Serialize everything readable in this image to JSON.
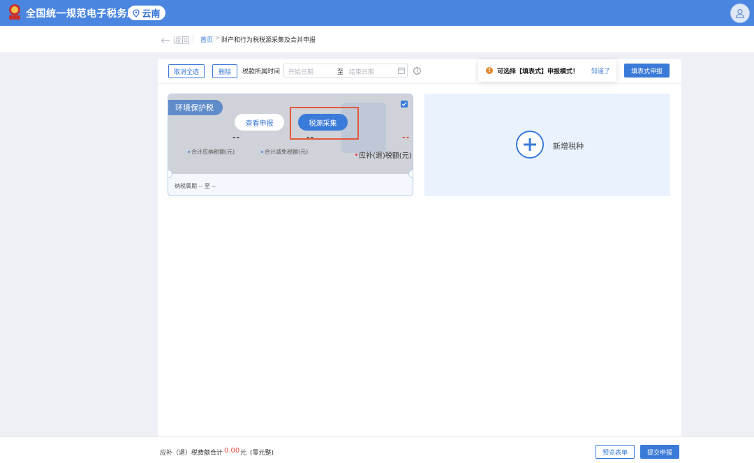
{
  "header": {
    "site_title": "全国统一规范电子税务局",
    "region": "云南",
    "brand_color": "#4a86e0"
  },
  "breadcrumb": {
    "back_label": "返回",
    "home": "首页",
    "separator": ">",
    "current": "财产和行为税税源采集及合并申报"
  },
  "toolbar": {
    "cancel_all_label": "取消全选",
    "delete_label": "删除",
    "period_label": "税款所属时间",
    "start_placeholder": "开始日期",
    "range_to": "至",
    "end_placeholder": "结束日期",
    "tip_text": "可选择【填表式】申报模式！",
    "tip_ok": "知道了",
    "fill_mode_label": "填表式申报"
  },
  "tax_card": {
    "tag": "环境保护税",
    "view_label": "查看申报",
    "source_label": "税源采集",
    "value_payable": "--",
    "value_reduction": "--",
    "value_refund": "--",
    "metric_payable": "合计应纳税额(元)",
    "metric_reduction": "合计减免税额(元)",
    "metric_refund": "应补(退)税额(元)",
    "period": "纳税属期 -- 至 --",
    "selected": true
  },
  "add_card": {
    "label": "新增税种"
  },
  "footer": {
    "sum_label": "应补（退）税费额合计",
    "sum_value": "0.00",
    "sum_unit": "元",
    "sum_cn": "(零元整)",
    "preview_label": "预览表单",
    "submit_label": "提交申报"
  }
}
